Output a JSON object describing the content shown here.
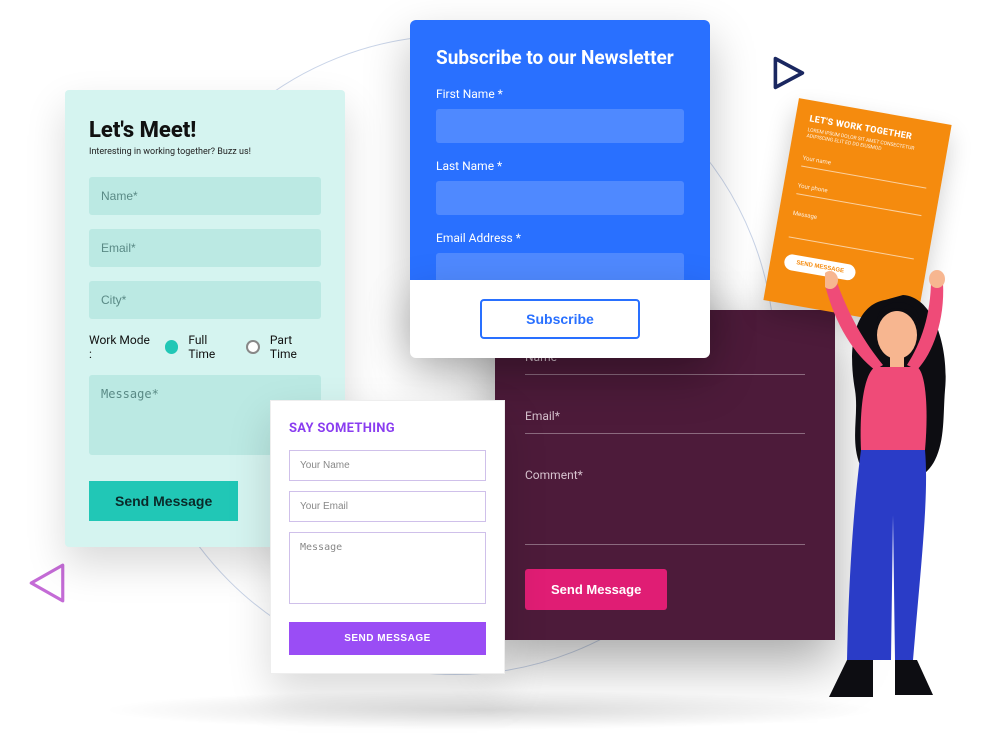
{
  "mint": {
    "title": "Let's Meet!",
    "subtitle": "Interesting in working together? Buzz us!",
    "name_ph": "Name*",
    "email_ph": "Email*",
    "city_ph": "City*",
    "workmode_label": "Work Mode :",
    "fulltime": "Full Time",
    "parttime": "Part Time",
    "message_ph": "Message*",
    "button": "Send Message"
  },
  "blue": {
    "title": "Subscribe to our Newsletter",
    "firstname": "First Name *",
    "lastname": "Last Name *",
    "email": "Email Address *",
    "button": "Subscribe"
  },
  "orange": {
    "title": "LET'S WORK TOGETHER",
    "subtitle": "LOREM IPSUM DOLOR SIT AMET CONSECTETUR ADIPISCING ELIT ED DO EIUSMOD",
    "name_ph": "Your name",
    "phone_ph": "Your  phone",
    "message_ph": "Message",
    "button": "SEND MESSAGE"
  },
  "maroon": {
    "name_ph": "Name*",
    "email_ph": "Email*",
    "comment_ph": "Comment*",
    "button": "Send Message"
  },
  "white": {
    "title": "SAY SOMETHING",
    "name_ph": "Your Name",
    "email_ph": "Your Email",
    "message_ph": "Message",
    "button": "SEND MESSAGE"
  }
}
